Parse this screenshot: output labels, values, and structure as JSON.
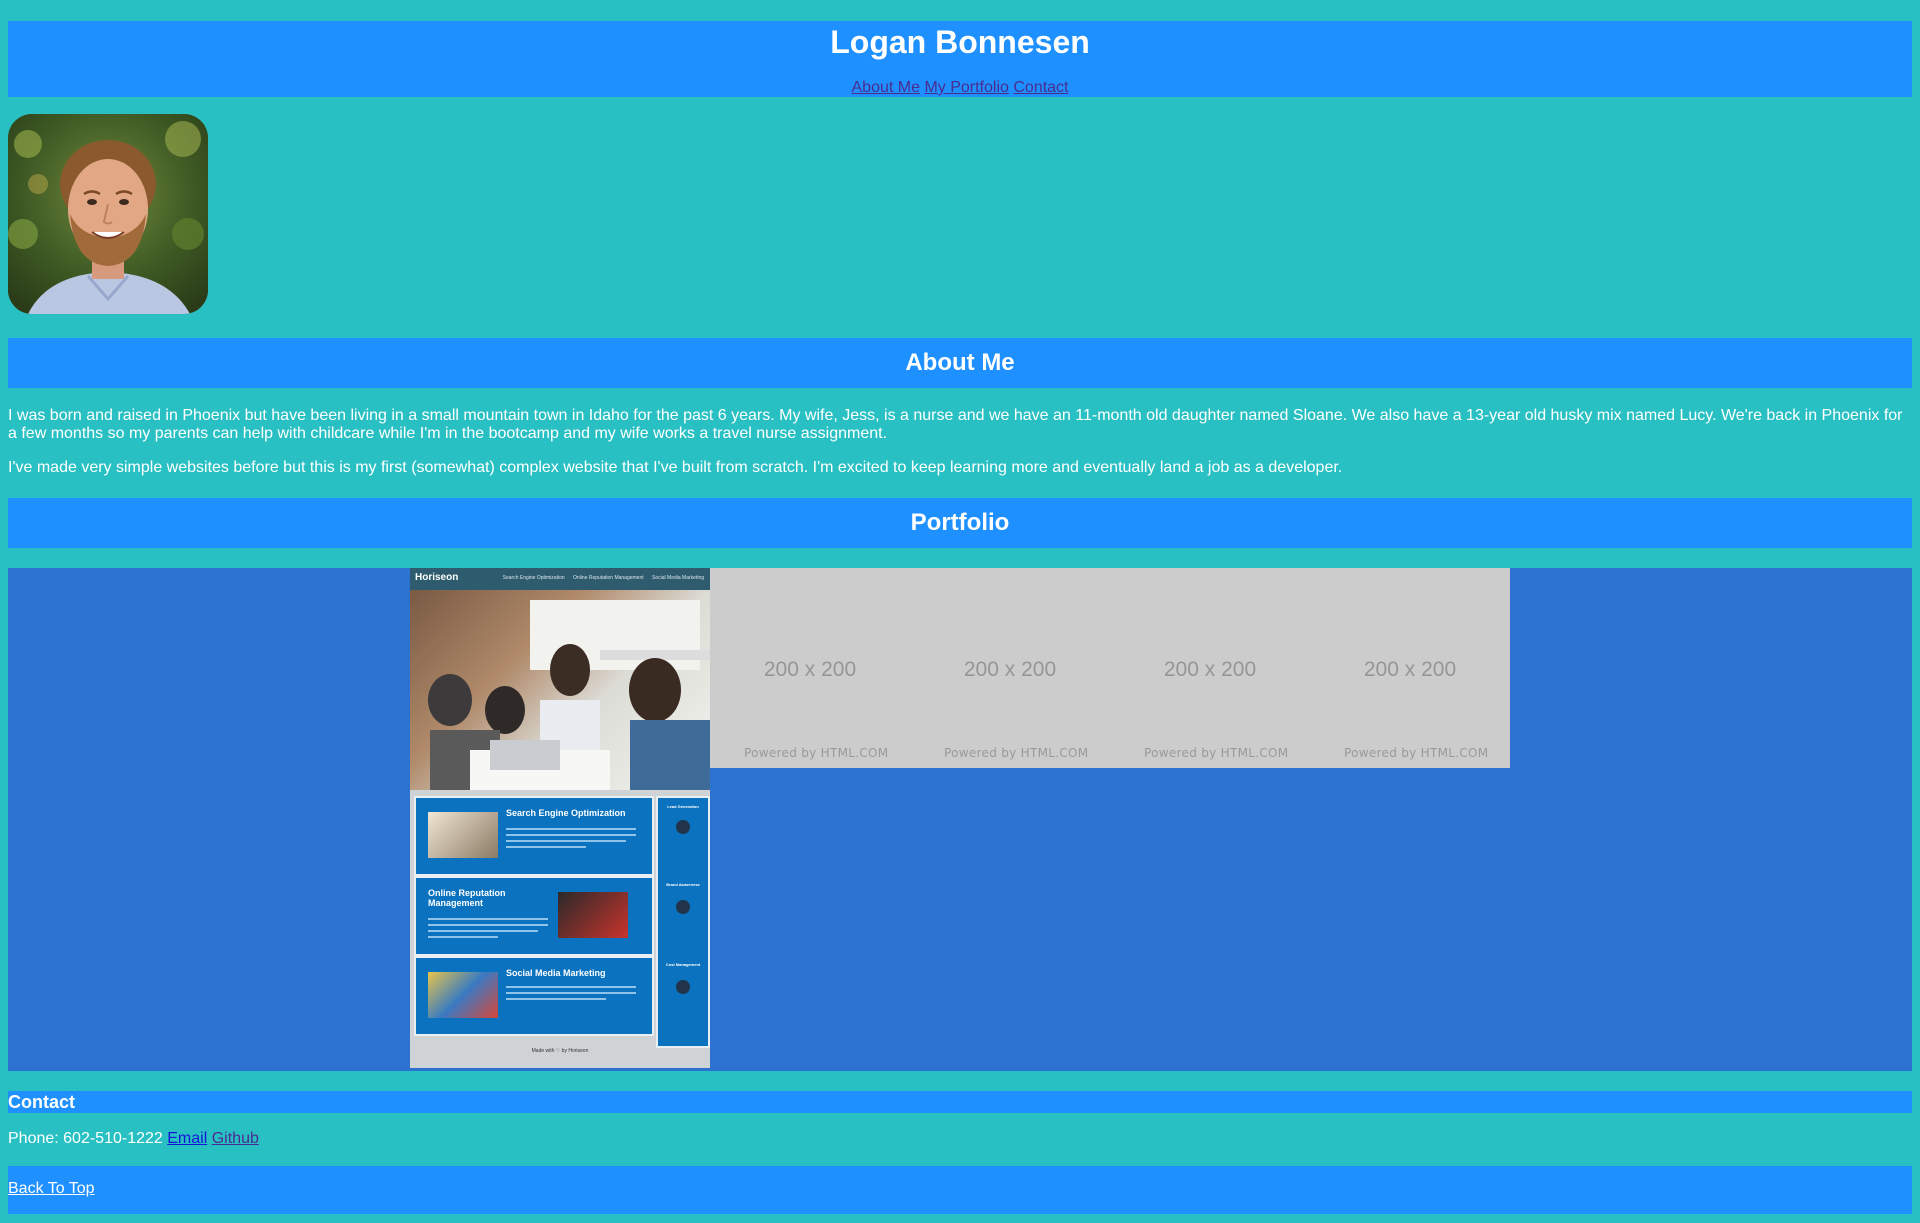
{
  "header": {
    "title": "Logan Bonnesen",
    "nav": [
      {
        "label": "About Me"
      },
      {
        "label": "My Portfolio"
      },
      {
        "label": "Contact"
      }
    ]
  },
  "about": {
    "heading": "About Me",
    "paragraphs": [
      "I was born and raised in Phoenix but have been living in a small mountain town in Idaho for the past 6 years. My wife, Jess, is a nurse and we have an 11-month old daughter named Sloane. We also have a 13-year old husky mix named Lucy. We're back in Phoenix for a few months so my parents can help with childcare while I'm in the bootcamp and my wife works a travel nurse assignment.",
      "I've made very simple websites before but this is my first (somewhat) complex website that I've built from scratch. I'm excited to keep learning more and eventually land a job as a developer."
    ]
  },
  "portfolio": {
    "heading": "Portfolio",
    "project": {
      "logo": "Horiseon",
      "nav": [
        "Search Engine Optimization",
        "Online Reputation Management",
        "Social Media Marketing"
      ],
      "cards": [
        {
          "title": "Search Engine Optimization"
        },
        {
          "title": "Online Reputation Management"
        },
        {
          "title": "Social Media Marketing"
        }
      ],
      "sidebar": [
        "Lead Generation",
        "Brand Awareness",
        "Cost Management"
      ],
      "footer": "Made with ♡ by Horiseon"
    },
    "placeholders": [
      {
        "size": "200 x 200",
        "powered": "Powered by HTML.COM"
      },
      {
        "size": "200 x 200",
        "powered": "Powered by HTML.COM"
      },
      {
        "size": "200 x 200",
        "powered": "Powered by HTML.COM"
      },
      {
        "size": "200 x 200",
        "powered": "Powered by HTML.COM"
      }
    ]
  },
  "contact": {
    "heading": "Contact",
    "phone": "Phone: 602-510-1222",
    "email_label": "Email",
    "github_label": "Github"
  },
  "footer": {
    "back_to_top": "Back To Top"
  },
  "colors": {
    "page_background": "#29c0c4",
    "bar_background": "#1f90ff",
    "portfolio_background": "#2b72d1"
  }
}
